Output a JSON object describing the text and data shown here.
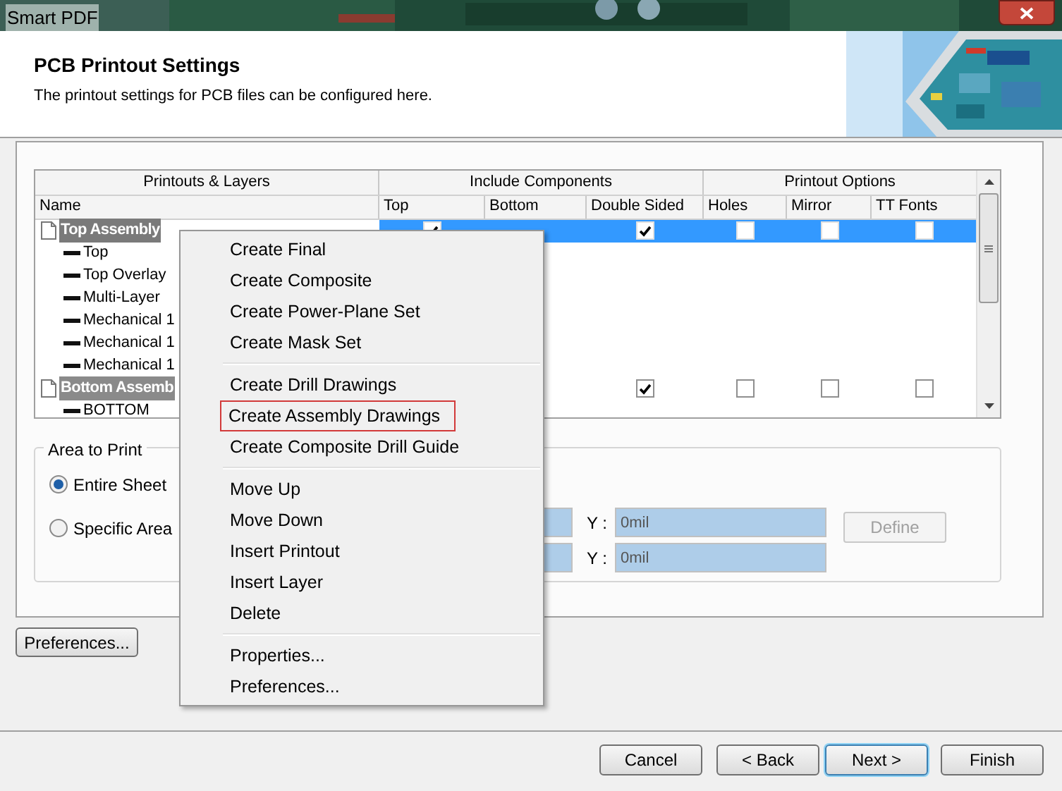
{
  "window": {
    "title": "Smart PDF"
  },
  "header": {
    "title": "PCB Printout Settings",
    "subtitle": "The printout settings for PCB files can be configured here.",
    "kind": "picture"
  },
  "table": {
    "groups": [
      "Printouts & Layers",
      "Include Components",
      "Printout Options"
    ],
    "columns": [
      "Name",
      "Top",
      "Bottom",
      "Double Sided",
      "Holes",
      "Mirror",
      "TT Fonts"
    ],
    "rows": [
      {
        "name": "Top Assembly",
        "selected": true,
        "options": {
          "top": true,
          "double_sided": true,
          "holes": false,
          "mirror": false,
          "tt_fonts": false
        },
        "children": [
          {
            "name": "Top"
          },
          {
            "name": "Top Overlay"
          },
          {
            "name": "Multi-Layer"
          },
          {
            "name": "Mechanical 1"
          },
          {
            "name": "Mechanical 1"
          },
          {
            "name": "Mechanical 1"
          }
        ]
      },
      {
        "name": "Bottom Assemb",
        "selected": false,
        "options": {
          "double_sided": true,
          "holes": false,
          "mirror": false,
          "tt_fonts": false
        },
        "children": [
          {
            "name": "BOTTOM"
          }
        ]
      }
    ]
  },
  "area_to_print": {
    "title": "Area to Print",
    "options": [
      {
        "label": "Entire Sheet",
        "selected": true
      },
      {
        "label": "Specific Area",
        "selected": false
      }
    ],
    "fields": [
      {
        "label": "Y :",
        "value": "0mil"
      },
      {
        "label": "Y :",
        "value": "0mil"
      }
    ],
    "define_button": {
      "label": "Define",
      "disabled": true
    }
  },
  "preferences_button": "Preferences...",
  "context_menu": [
    [
      {
        "label": "Create Final",
        "highlighted": false
      },
      {
        "label": "Create Composite",
        "highlighted": false
      },
      {
        "label": "Create Power-Plane Set",
        "highlighted": false
      },
      {
        "label": "Create Mask Set",
        "highlighted": false
      }
    ],
    [
      {
        "label": "Create Drill Drawings",
        "highlighted": false
      },
      {
        "label": "Create Assembly Drawings",
        "highlighted": true
      },
      {
        "label": "Create Composite Drill Guide",
        "highlighted": false
      }
    ],
    [
      {
        "label": "Move Up",
        "highlighted": false
      },
      {
        "label": "Move Down",
        "highlighted": false
      },
      {
        "label": "Insert Printout",
        "highlighted": false
      },
      {
        "label": "Insert Layer",
        "highlighted": false
      },
      {
        "label": "Delete",
        "highlighted": false
      }
    ],
    [
      {
        "label": "Properties...",
        "highlighted": false
      },
      {
        "label": "Preferences...",
        "highlighted": false
      }
    ]
  ],
  "buttons": [
    {
      "label": "Cancel",
      "default": false
    },
    {
      "label": "< Back",
      "default": false
    },
    {
      "label": "Next >",
      "default": true
    },
    {
      "label": "Finish",
      "default": false
    }
  ]
}
